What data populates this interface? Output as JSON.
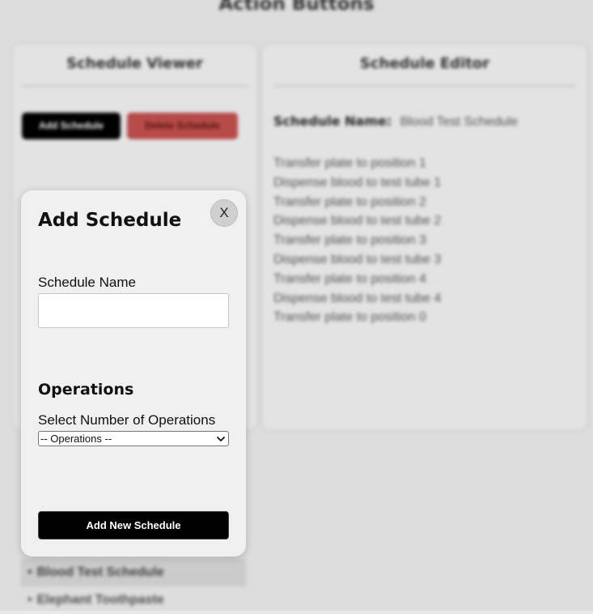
{
  "page": {
    "title": "Action Buttons"
  },
  "viewer": {
    "title": "Schedule Viewer",
    "add_button": "Add Schedule",
    "delete_button": "Delete Schedule",
    "schedules": [
      {
        "name": "Blood Test Schedule",
        "bullet": "•"
      },
      {
        "name": "Elephant Toothpaste",
        "bullet": "•"
      }
    ]
  },
  "editor": {
    "title": "Schedule Editor",
    "name_label": "Schedule Name:",
    "name_value": "Blood Test Schedule",
    "operations": [
      "Transfer plate to position 1",
      "Dispense blood to test tube 1",
      "Transfer plate to position 2",
      "Dispense blood to test tube 2",
      "Transfer plate to position 3",
      "Dispense blood to test tube 3",
      "Transfer plate to position 4",
      "Dispense blood to test tube 4",
      "Transfer plate to position 0"
    ]
  },
  "modal": {
    "close_label": "X",
    "title": "Add Schedule",
    "name_label": "Schedule Name",
    "name_value": "",
    "operations_heading": "Operations",
    "select_label": "Select Number of Operations",
    "select_value": "-- Operations --",
    "submit_label": "Add New Schedule"
  },
  "colors": {
    "primary_button": "#000000",
    "danger_button": "#c0504d",
    "panel_background": "#f0f0f0",
    "page_background": "#e9e9e9"
  },
  "icons": {
    "select_chevron": "chevron-down-icon"
  }
}
